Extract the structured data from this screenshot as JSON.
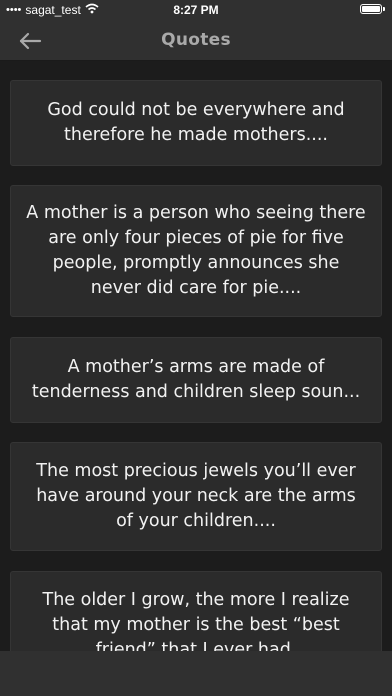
{
  "status_bar": {
    "carrier": "sagat_test",
    "time": "8:27 PM"
  },
  "header": {
    "title": "Quotes",
    "back_icon": "back-arrow-icon"
  },
  "quotes": [
    {
      "text": "God could not be everywhere and therefore he made mothers...."
    },
    {
      "text": "A mother is a person who seeing there are only four pieces of pie for five people, promptly announces she never did care for pie...."
    },
    {
      "text": "A mother’s arms are made of tenderness and children sleep soun..."
    },
    {
      "text": "The most precious jewels you’ll ever have around your neck are the arms of your children...."
    },
    {
      "text": "The older I grow, the more I realize that my mother is the best “best friend” that I ever had."
    }
  ],
  "colors": {
    "background": "#1c1c1c",
    "bar": "#303030",
    "card": "#2b2b2b",
    "title": "#a9a9a9",
    "text": "#f2f2f2"
  }
}
